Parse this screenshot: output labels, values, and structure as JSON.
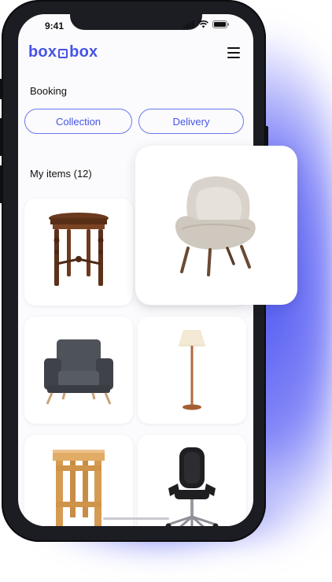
{
  "status_bar": {
    "time": "9:41"
  },
  "header": {
    "logo_left": "box",
    "logo_right": "box"
  },
  "booking": {
    "title": "Booking",
    "collection_label": "Collection",
    "delivery_label": "Delivery"
  },
  "items": {
    "title": "My items (12)",
    "list": [
      {
        "icon": "side-table-icon"
      },
      {
        "icon": "armchair-icon"
      },
      {
        "icon": "grey-armchair-icon"
      },
      {
        "icon": "floor-lamp-icon"
      },
      {
        "icon": "wooden-stool-icon"
      },
      {
        "icon": "office-chair-icon"
      }
    ]
  },
  "colors": {
    "accent": "#4653e6",
    "phone_frame": "#1c1d22",
    "glow": "#4b55f0"
  }
}
